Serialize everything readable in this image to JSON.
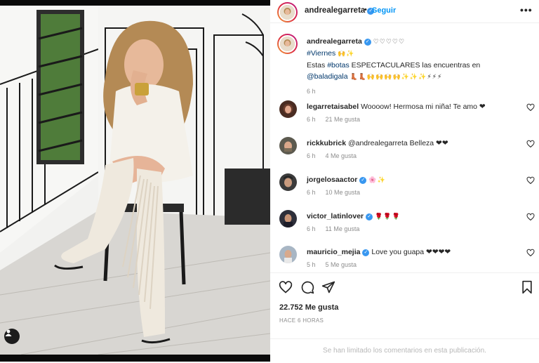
{
  "header": {
    "username": "andrealegarreta",
    "separator": "•",
    "follow_label": "Seguir",
    "more_label": "•••"
  },
  "caption": {
    "username": "andrealegarreta",
    "line1_emojis": "♡♡♡♡♡",
    "hashtag1": "#Viernes",
    "line2_emojis": "🙌✨",
    "text_start": "Estas ",
    "hashtag2": "#botas",
    "text_rest": " ESPECTACULARES las encuentras en",
    "mention": "@baladigala",
    "line4_emojis": "👢👢🙌🙌🙌🙌✨✨✨⚡⚡⚡",
    "time": "6 h"
  },
  "comments": [
    {
      "username": "legarretaisabel",
      "verified": false,
      "text": "Woooow! Hermosa mi niña! Te amo ❤",
      "time": "6 h",
      "likes": "21 Me gusta"
    },
    {
      "username": "rickkubrick",
      "verified": false,
      "text": "@andrealegarreta Belleza ❤❤",
      "time": "6 h",
      "likes": "4 Me gusta"
    },
    {
      "username": "jorgelosaactor",
      "verified": true,
      "text": "🌸✨",
      "time": "6 h",
      "likes": "10 Me gusta"
    },
    {
      "username": "victor_latinlover",
      "verified": true,
      "text": "🌹🌹🌹",
      "time": "6 h",
      "likes": "11 Me gusta"
    },
    {
      "username": "mauricio_mejia",
      "verified": true,
      "text": "Love you guapa ❤❤❤❤",
      "time": "5 h",
      "likes": "5 Me gusta"
    }
  ],
  "post": {
    "likes": "22.752 Me gusta",
    "date": "HACE 6 HORAS",
    "comments_limited": "Se han limitado los comentarios en esta publicación."
  },
  "colors": {
    "link": "#00376b",
    "follow": "#0095f6",
    "heart": "#ed4956",
    "verified": "#3897f0"
  },
  "icons": [
    "heart-icon",
    "comment-icon",
    "share-icon",
    "bookmark-icon",
    "more-icon",
    "user-tag-icon",
    "verified-icon"
  ]
}
